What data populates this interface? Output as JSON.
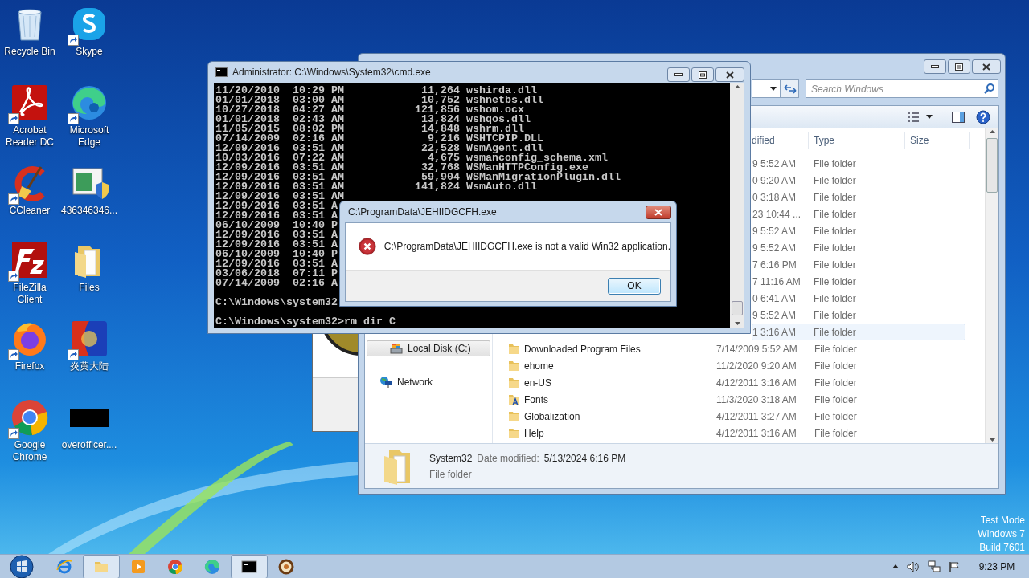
{
  "desktop_icons": [
    {
      "label": "Recycle Bin",
      "kind": "recycle-bin",
      "shortcut": false
    },
    {
      "label": "Skype",
      "kind": "skype",
      "shortcut": true
    },
    {
      "label": "Acrobat Reader DC",
      "kind": "acrobat",
      "shortcut": true
    },
    {
      "label": "Microsoft Edge",
      "kind": "edge",
      "shortcut": true
    },
    {
      "label": "CCleaner",
      "kind": "ccleaner",
      "shortcut": true
    },
    {
      "label": "436346346...",
      "kind": "installer",
      "shortcut": false
    },
    {
      "label": "FileZilla Client",
      "kind": "filezilla",
      "shortcut": true
    },
    {
      "label": "Files",
      "kind": "folder",
      "shortcut": false
    },
    {
      "label": "Firefox",
      "kind": "firefox",
      "shortcut": true
    },
    {
      "label": "炎黄大陆",
      "kind": "game",
      "shortcut": true
    },
    {
      "label": "Google Chrome",
      "kind": "chrome",
      "shortcut": true
    },
    {
      "label": "overofficer....",
      "kind": "black-file",
      "shortcut": false
    }
  ],
  "explorer": {
    "search": {
      "placeholder": "Search Windows"
    },
    "columns": [
      "dified",
      "Type",
      "Size"
    ],
    "covered_rows": [
      {
        "date": "9 5:52 AM",
        "type": "File folder",
        "hovered": false
      },
      {
        "date": "0 9:20 AM",
        "type": "File folder",
        "hovered": false
      },
      {
        "date": "0 3:18 AM",
        "type": "File folder",
        "hovered": false
      },
      {
        "date": "23 10:44 ...",
        "type": "File folder",
        "hovered": false
      },
      {
        "date": "9 5:52 AM",
        "type": "File folder",
        "hovered": false
      },
      {
        "date": "9 5:52 AM",
        "type": "File folder",
        "hovered": false
      },
      {
        "date": "7 6:16 PM",
        "type": "File folder",
        "hovered": false
      },
      {
        "date": "7 11:16 AM",
        "type": "File folder",
        "hovered": false
      },
      {
        "date": "0 6:41 AM",
        "type": "File folder",
        "hovered": false
      },
      {
        "date": "9 5:52 AM",
        "type": "File folder",
        "hovered": false
      },
      {
        "date": "1 3:16 AM",
        "type": "File folder",
        "hovered": true
      }
    ],
    "rows": [
      {
        "name": "Downloaded Program Files",
        "date": "7/14/2009 5:52 AM",
        "type": "File folder",
        "kind": "folder",
        "hovered": false
      },
      {
        "name": "ehome",
        "date": "11/2/2020 9:20 AM",
        "type": "File folder",
        "kind": "folder",
        "hovered": false
      },
      {
        "name": "en-US",
        "date": "4/12/2011 3:16 AM",
        "type": "File folder",
        "kind": "folder",
        "hovered": false
      },
      {
        "name": "Fonts",
        "date": "11/3/2020 3:18 AM",
        "type": "File folder",
        "kind": "fonts",
        "hovered": false
      },
      {
        "name": "Globalization",
        "date": "4/12/2011 3:27 AM",
        "type": "File folder",
        "kind": "folder",
        "hovered": false
      },
      {
        "name": "Help",
        "date": "4/12/2011 3:16 AM",
        "type": "File folder",
        "kind": "folder",
        "hovered": false
      }
    ],
    "nav": [
      {
        "label": "Local Disk (C:)",
        "kind": "drive",
        "selected": true
      },
      {
        "label": "Network",
        "kind": "network",
        "selected": false
      }
    ],
    "details": {
      "name": "System32",
      "date_label": "Date modified:",
      "date": "5/13/2024 6:16 PM",
      "type": "File folder"
    }
  },
  "cmd": {
    "title": "Administrator: C:\\Windows\\System32\\cmd.exe",
    "lines": [
      {
        "text": "11/20/2010  10:29 PM            11,264 wshirda.dll",
        "kind": "output"
      },
      {
        "text": "01/01/2018  03:00 AM            10,752 wshnetbs.dll",
        "kind": "output"
      },
      {
        "text": "10/27/2018  04:27 AM           121,856 wshom.ocx",
        "kind": "output"
      },
      {
        "text": "01/01/2018  02:43 AM            13,824 wshqos.dll",
        "kind": "output"
      },
      {
        "text": "11/05/2015  08:02 PM            14,848 wshrm.dll",
        "kind": "output"
      },
      {
        "text": "07/14/2009  02:16 AM             9,216 WSHTCPIP.DLL",
        "kind": "output"
      },
      {
        "text": "12/09/2016  03:51 AM            22,528 WsmAgent.dll",
        "kind": "output"
      },
      {
        "text": "10/03/2016  07:22 AM             4,675 wsmanconfig_schema.xml",
        "kind": "output"
      },
      {
        "text": "12/09/2016  03:51 AM            32,768 WSManHTTPConfig.exe",
        "kind": "output"
      },
      {
        "text": "12/09/2016  03:51 AM            59,904 WSManMigrationPlugin.dll",
        "kind": "output"
      },
      {
        "text": "12/09/2016  03:51 AM           141,824 WsmAuto.dll",
        "kind": "output"
      },
      {
        "text": "12/09/2016  03:51 AM",
        "kind": "output"
      },
      {
        "text": "12/09/2016  03:51 A",
        "kind": "output"
      },
      {
        "text": "12/09/2016  03:51 A",
        "kind": "output"
      },
      {
        "text": "06/10/2009  10:40 P",
        "kind": "output"
      },
      {
        "text": "12/09/2016  03:51 A",
        "kind": "output"
      },
      {
        "text": "12/09/2016  03:51 A",
        "kind": "output"
      },
      {
        "text": "06/10/2009  10:40 P",
        "kind": "output"
      },
      {
        "text": "12/09/2016  03:51 A",
        "kind": "output"
      },
      {
        "text": "03/06/2018  07:11 P",
        "kind": "output"
      },
      {
        "text": "07/14/2009  02:16 A",
        "kind": "output"
      },
      {
        "text": "C:\\Windows\\system32",
        "kind": "prompt"
      },
      {
        "text": "C:\\Windows\\system32>rm dir C",
        "kind": "prompt"
      }
    ]
  },
  "dialog": {
    "title": "C:\\ProgramData\\JEHIIDGCFH.exe",
    "message": "C:\\ProgramData\\JEHIIDGCFH.exe is not a valid Win32 application.",
    "button": "OK"
  },
  "os_notice": [
    "Test Mode",
    "Windows 7",
    "Build 7601"
  ],
  "taskbar": {
    "items": [
      {
        "kind": "ie",
        "active": false
      },
      {
        "kind": "explorer",
        "active": true
      },
      {
        "kind": "media",
        "active": false
      },
      {
        "kind": "chrome",
        "active": false
      },
      {
        "kind": "edge",
        "active": false
      },
      {
        "kind": "cmd",
        "active": true
      },
      {
        "kind": "app",
        "active": false
      }
    ],
    "clock": "9:23 PM"
  }
}
